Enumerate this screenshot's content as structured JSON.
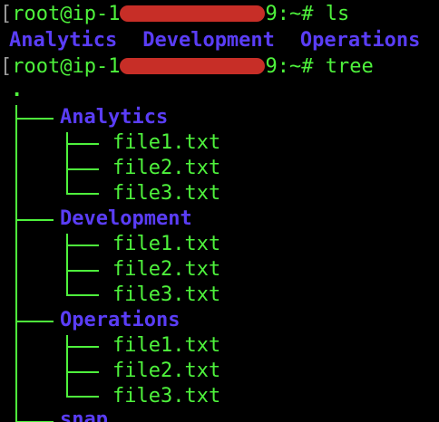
{
  "prompt": {
    "user_host": "root@ip-1",
    "suffix_1": "9:~# ",
    "suffix_2": "9:~# ",
    "command_1": "ls",
    "command_2": "tree"
  },
  "ls_output": [
    "Analytics",
    "Development",
    "Operations"
  ],
  "tree": {
    "root": ".",
    "dirs": [
      {
        "name": "Analytics",
        "files": [
          "file1.txt",
          "file2.txt",
          "file3.txt"
        ]
      },
      {
        "name": "Development",
        "files": [
          "file1.txt",
          "file2.txt",
          "file3.txt"
        ]
      },
      {
        "name": "Operations",
        "files": [
          "file1.txt",
          "file2.txt",
          "file3.txt"
        ]
      },
      {
        "name": "snap",
        "files": []
      }
    ]
  },
  "colors": {
    "background": "#000000",
    "text_green": "#4ef23c",
    "dir_blue": "#5a3df6",
    "redaction": "#d8322a"
  }
}
